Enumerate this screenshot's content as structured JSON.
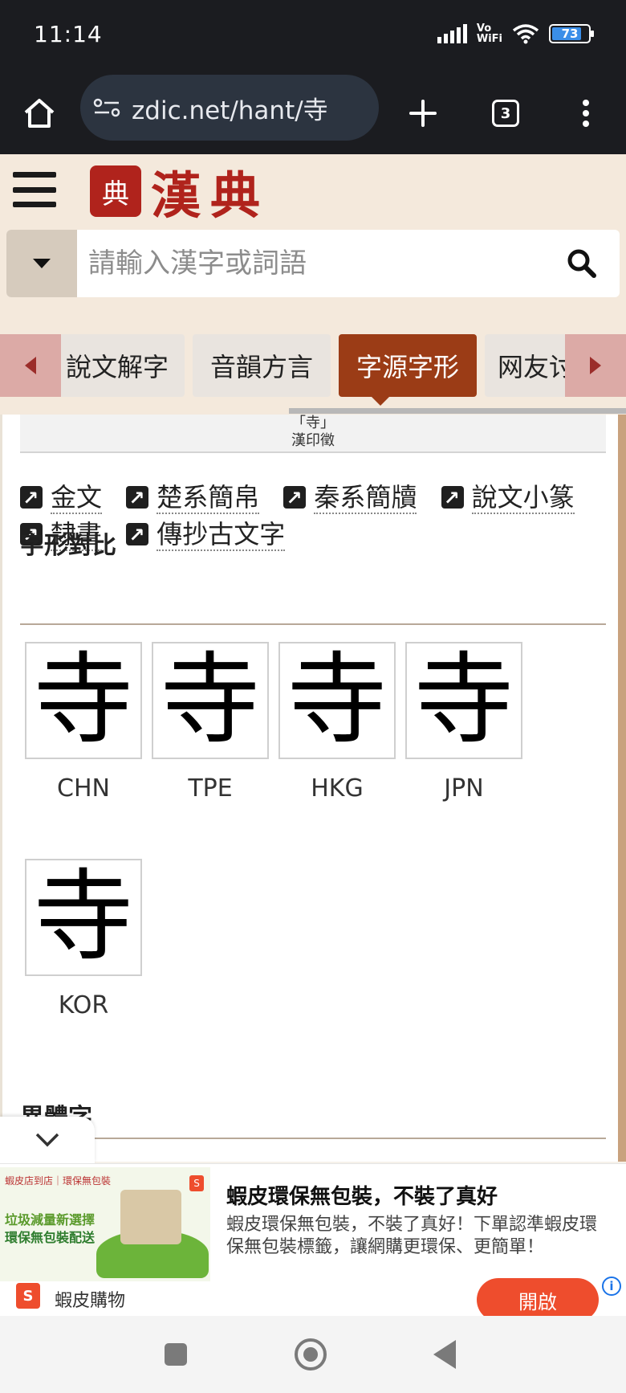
{
  "status_bar": {
    "time": "11:14",
    "vowifi_line1": "Vo",
    "vowifi_line2": "WiFi",
    "battery": "73"
  },
  "browser": {
    "url": "zdic.net/hant/寺",
    "tab_count": "3"
  },
  "site": {
    "logo_seal": "典",
    "logo_text": "漢典",
    "search_placeholder": "請輸入漢字或詞語"
  },
  "tabs": [
    {
      "label": "說文解字",
      "active": false
    },
    {
      "label": "音韻方言",
      "active": false
    },
    {
      "label": "字源字形",
      "active": true
    },
    {
      "label": "网友讨论",
      "active": false
    }
  ],
  "content": {
    "seal_caption_line1": "「寺」",
    "seal_caption_line2": "漢印徵",
    "glyph_links": [
      "金文",
      "楚系簡帛",
      "秦系簡牘",
      "說文小篆",
      "隸書",
      "傳抄古文字"
    ],
    "comparison_title": "字形對比",
    "glyph_char": "寺",
    "comparisons": [
      {
        "region": "CHN"
      },
      {
        "region": "TPE"
      },
      {
        "region": "HKG"
      },
      {
        "region": "JPN"
      },
      {
        "region": "KOR"
      }
    ],
    "variants_title": "異體字"
  },
  "ad": {
    "image_tag": "蝦皮店到店｜環保無包裝",
    "image_line1": "垃圾減量新選擇",
    "image_line2": "環保無包裝配送",
    "title": "蝦皮環保無包裝，不裝了真好",
    "description": "蝦皮環保無包裝，不裝了真好！下單認準蝦皮環保無包裝標籤，讓網購更環保、更簡單！",
    "brand": "蝦皮購物",
    "cta": "開啟",
    "brand_color": "#ee4d2d"
  },
  "colors": {
    "accent": "#9b3c16",
    "logo_red": "#b0231c",
    "header_bg": "#f4e9dc"
  }
}
